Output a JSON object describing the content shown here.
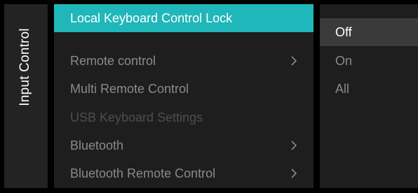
{
  "side_panel": {
    "title": "Input Control"
  },
  "menu": {
    "items": [
      {
        "label": "Local Keyboard Control Lock",
        "has_submenu": false,
        "state": "selected"
      },
      {
        "label": "Remote control",
        "has_submenu": true,
        "state": "normal"
      },
      {
        "label": "Multi Remote Control",
        "has_submenu": false,
        "state": "normal"
      },
      {
        "label": "USB Keyboard Settings",
        "has_submenu": false,
        "state": "disabled"
      },
      {
        "label": "Bluetooth",
        "has_submenu": true,
        "state": "normal"
      },
      {
        "label": "Bluetooth Remote Control",
        "has_submenu": true,
        "state": "normal"
      }
    ]
  },
  "options": {
    "items": [
      {
        "label": "Off",
        "state": "selected"
      },
      {
        "label": "On",
        "state": "normal"
      },
      {
        "label": "All",
        "state": "normal"
      }
    ]
  },
  "colors": {
    "accent": "#1fb7b9",
    "panel_background": "#1e1e1e",
    "text_normal": "#8a8a8a",
    "text_disabled": "#4e4e4e",
    "text_selected": "#ffffff"
  }
}
